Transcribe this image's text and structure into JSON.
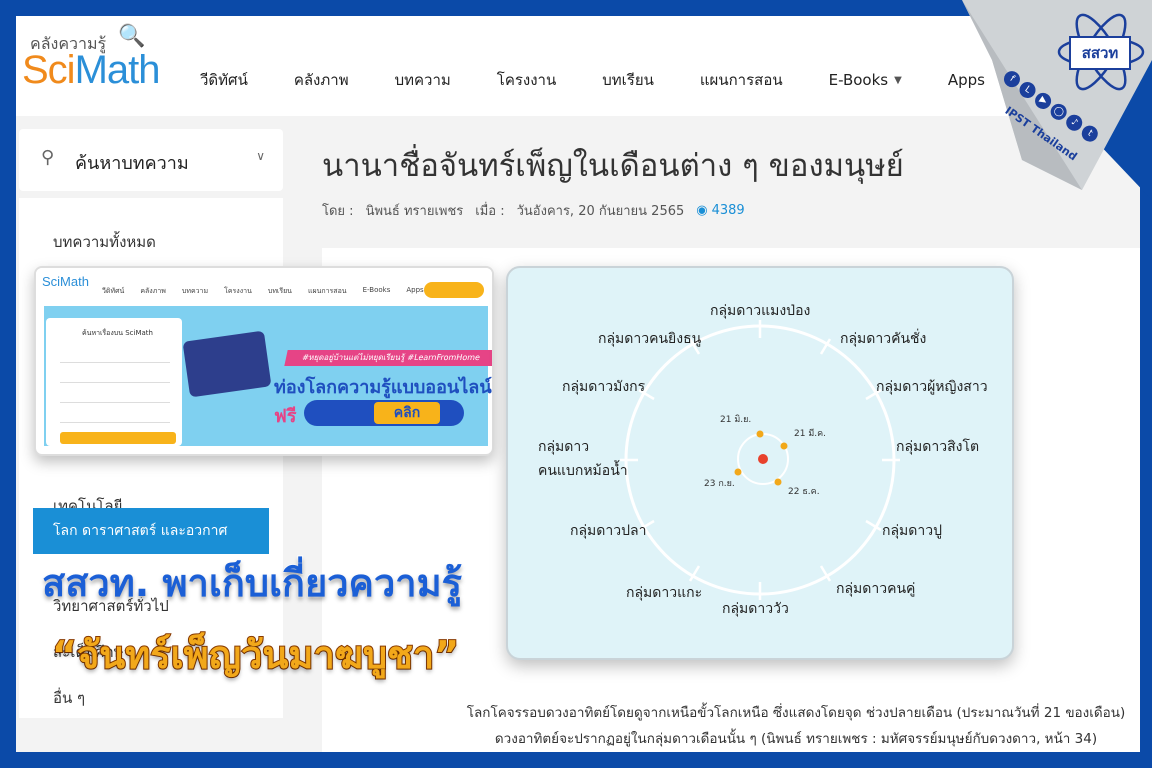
{
  "site": {
    "logo_small": "คลังความรู้",
    "logo_sci": "Sci",
    "logo_math": "Math",
    "nav": [
      "วีดิทัศน์",
      "คลังภาพ",
      "บทความ",
      "โครงงาน",
      "บทเรียน",
      "แผนการสอน",
      "E-Books",
      "Apps"
    ]
  },
  "sidebar": {
    "search_label": "ค้นหาบทความ",
    "items": [
      "บทความทั้งหมด",
      "เทคโนโลยี",
      "โลก ดาราศาสตร์ และอวกาศ",
      "วิทยาศาสตร์ทั่วไป",
      "สะเต็มศึกษา",
      "อื่น ๆ"
    ]
  },
  "article": {
    "title": "นานาชื่อจันทร์เพ็ญในเดือนต่าง ๆ ของมนุษย์",
    "by_label": "โดย :",
    "author": "นิพนธ์ ทรายเพชร",
    "date_label": "เมื่อ :",
    "date": "วันอังคาร, 20 กันยายน 2565",
    "views": "4389",
    "caption_line1": "โลกโคจรรอบดวงอาทิตย์โดยดูจากเหนือขั้วโลกเหนือ ซึ่งแสดงโดยจุด ช่วงปลายเดือน (ประมาณวันที่ 21 ของเดือน)",
    "caption_line2": "ดวงอาทิตย์จะปรากฏอยู่ในกลุ่มดาวเดือนนั้น ๆ (นิพนธ์ ทรายเพชร : มหัศจรรย์มนุษย์กับดวงดาว, หน้า 34)"
  },
  "thumbnail": {
    "logo": "SciMath",
    "nav": [
      "วีดิทัศน์",
      "คลังภาพ",
      "บทความ",
      "โครงงาน",
      "บทเรียน",
      "แผนการสอน",
      "E-Books",
      "Apps"
    ],
    "panel_title": "ค้นหาเรื่องบน SciMath",
    "pink_banner": "#หยุดอยู่บ้านแต่ไม่หยุดเรียนรู้ #LearnFromHome",
    "headline": "ท่องโลกความรู้แบบออนไลน์",
    "headline_free": "ฟรี",
    "click_label": "คลิก"
  },
  "constellations": {
    "labels": [
      "กลุ่มดาวแมงป่อง",
      "กลุ่มดาวคนยิงธนู",
      "กลุ่มดาวคันชั่ง",
      "กลุ่มดาวมังกร",
      "กลุ่มดาวผู้หญิงสาว",
      "กลุ่มดาว",
      "คนแบกหม้อน้ำ",
      "กลุ่มดาวสิงโต",
      "กลุ่มดาวปลา",
      "กลุ่มดาวปู",
      "กลุ่มดาวแกะ",
      "กลุ่มดาวคนคู่",
      "กลุ่มดาววัว"
    ],
    "dates": [
      "21 มิ.ย.",
      "21 มี.ค.",
      "23 ก.ย.",
      "22 ธ.ค."
    ]
  },
  "promo": {
    "line1": "สสวท. พาเก็บเกี่ยวความรู้",
    "line2": "“จันทร์เพ็ญวันมาฆบูชา”"
  },
  "brand": {
    "ipst": "สสวท",
    "handle": "IPST Thailand"
  }
}
